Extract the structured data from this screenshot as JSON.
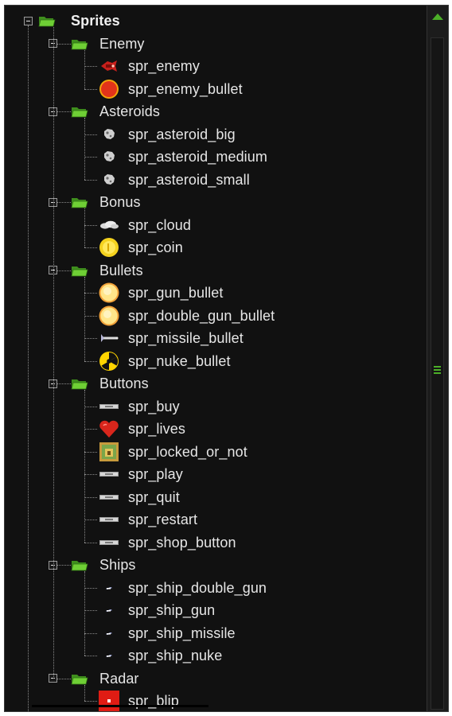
{
  "tree": {
    "root": {
      "label": "Sprites",
      "icon": "folder-open-icon",
      "expanded": true
    },
    "groups": [
      {
        "label": "Enemy",
        "items": [
          {
            "label": "spr_enemy",
            "icon": "enemy-ship-icon"
          },
          {
            "label": "spr_enemy_bullet",
            "icon": "red-orb-icon"
          }
        ]
      },
      {
        "label": "Asteroids",
        "items": [
          {
            "label": "spr_asteroid_big",
            "icon": "asteroid-icon"
          },
          {
            "label": "spr_asteroid_medium",
            "icon": "asteroid-icon"
          },
          {
            "label": "spr_asteroid_small",
            "icon": "asteroid-icon"
          }
        ]
      },
      {
        "label": "Bonus",
        "items": [
          {
            "label": "spr_cloud",
            "icon": "cloud-icon"
          },
          {
            "label": "spr_coin",
            "icon": "coin-icon"
          }
        ]
      },
      {
        "label": "Bullets",
        "items": [
          {
            "label": "spr_gun_bullet",
            "icon": "yellow-orb-icon"
          },
          {
            "label": "spr_double_gun_bullet",
            "icon": "yellow-orb-icon"
          },
          {
            "label": "spr_missile_bullet",
            "icon": "missile-icon"
          },
          {
            "label": "spr_nuke_bullet",
            "icon": "radiation-icon"
          }
        ]
      },
      {
        "label": "Buttons",
        "items": [
          {
            "label": "spr_buy",
            "icon": "button-sprite-icon"
          },
          {
            "label": "spr_lives",
            "icon": "heart-icon"
          },
          {
            "label": "spr_locked_or_not",
            "icon": "lock-box-icon"
          },
          {
            "label": "spr_play",
            "icon": "button-sprite-icon"
          },
          {
            "label": "spr_quit",
            "icon": "button-sprite-icon"
          },
          {
            "label": "spr_restart",
            "icon": "button-sprite-icon"
          },
          {
            "label": "spr_shop_button",
            "icon": "button-sprite-icon"
          }
        ]
      },
      {
        "label": "Ships",
        "items": [
          {
            "label": "spr_ship_double_gun",
            "icon": "small-ship-icon"
          },
          {
            "label": "spr_ship_gun",
            "icon": "small-ship-icon"
          },
          {
            "label": "spr_ship_missile",
            "icon": "small-ship-icon"
          },
          {
            "label": "spr_ship_nuke",
            "icon": "small-ship-icon"
          }
        ]
      },
      {
        "label": "Radar",
        "items": [
          {
            "label": "spr_blip",
            "icon": "radar-blip-icon"
          }
        ]
      }
    ]
  },
  "scrollbar": {
    "up_icon": "scroll-up-arrow-icon",
    "grip_icon": "scroll-grip-icon"
  },
  "colors": {
    "background": "#111111",
    "text": "#e6e6e6",
    "accent_green": "#4caf28",
    "folder_green": "#5cb82a",
    "dotted_line": "#8a8a8a"
  }
}
